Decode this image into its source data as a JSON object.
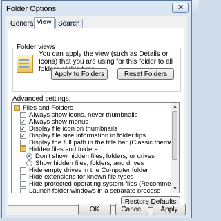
{
  "window": {
    "title": "Folder Options",
    "close_glyph": "✕"
  },
  "tabs": [
    {
      "label": "General",
      "active": false
    },
    {
      "label": "View",
      "active": true
    },
    {
      "label": "Search",
      "active": false
    }
  ],
  "folder_views": {
    "group_label": "Folder views",
    "description": "You can apply the view (such as Details or Icons) that you are using for this folder to all folders of this type.",
    "apply_button": "Apply to Folders",
    "reset_button": "Reset Folders"
  },
  "advanced": {
    "label": "Advanced settings:",
    "items": [
      {
        "type": "folder",
        "label": "Files and Folders"
      },
      {
        "type": "checkbox",
        "checked": false,
        "label": "Always show icons, never thumbnails"
      },
      {
        "type": "checkbox",
        "checked": true,
        "label": "Always show menus"
      },
      {
        "type": "checkbox",
        "checked": true,
        "label": "Display file icon on thumbnails"
      },
      {
        "type": "checkbox",
        "checked": true,
        "label": "Display file size information in folder tips"
      },
      {
        "type": "checkbox",
        "checked": false,
        "label": "Display the full path in the title bar (Classic theme only)"
      },
      {
        "type": "folder",
        "label": "Hidden files and folders"
      },
      {
        "type": "radio",
        "checked": true,
        "label": "Don't show hidden files, folders, or drives"
      },
      {
        "type": "radio",
        "checked": false,
        "label": "Show hidden files, folders, and drives"
      },
      {
        "type": "checkbox",
        "checked": false,
        "label": "Hide empty drives in the Computer folder"
      },
      {
        "type": "checkbox",
        "checked": false,
        "label": "Hide extensions for known file types"
      },
      {
        "type": "checkbox",
        "checked": false,
        "label": "Hide protected operating system files (Recommended)"
      },
      {
        "type": "checkbox",
        "checked": false,
        "label": "Launch folder windows in a separate process"
      }
    ],
    "restore_button": "Restore Defaults"
  },
  "footer": {
    "ok": "OK",
    "cancel": "Cancel",
    "apply": "Apply"
  },
  "colors": {
    "selection_accent": "#2a5db0",
    "title_bar": "#dbe6f3"
  }
}
